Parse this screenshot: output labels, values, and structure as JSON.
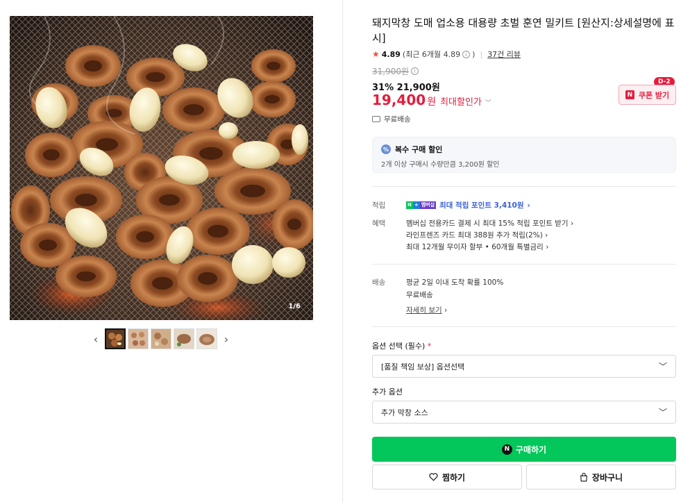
{
  "gallery": {
    "counter": "1/6",
    "prev_icon": "chevron-left-icon",
    "next_icon": "chevron-right-icon",
    "thumb_count": 5,
    "prev_glyph": "‹",
    "next_glyph": "›"
  },
  "product": {
    "title": "돼지막창 도매 업소용 대용량 초벌 훈연 밀키트 [원산지:상세설명에 표시]",
    "rating": "4.89",
    "recent_rating": "(최근 6개월 4.89",
    "recent_close": ")",
    "review_link": "37건 리뷰",
    "original_price": "31,900원",
    "discount_pct": "31%",
    "sale_price": "21,900원",
    "max_price": "19,400",
    "won": "원",
    "max_label": "최대할인가",
    "shipping": "무료배송"
  },
  "coupon": {
    "label": "쿠폰 받기",
    "badge": "D-2",
    "n_mark": "N"
  },
  "multi_discount": {
    "title": "복수 구매 할인",
    "desc": "2개 이상 구매시 수량만큼 3,200원 할인",
    "icon": "%"
  },
  "benefits": {
    "points_label": "적립",
    "points_text": "최대 적립 포인트 3,410원",
    "benefit_label": "혜택",
    "benefit_lines": [
      "멤버십 전용카드 결제 시 최대 15% 적립 포인트 받기",
      "라인프렌즈 카드 최대 388원 추가 적립(2%)",
      "최대 12개월 무이자 할부 • 60개월 특별금리"
    ]
  },
  "delivery": {
    "label": "배송",
    "line1": "평균 2일 이내 도착 확률 100%",
    "line2": "무료배송",
    "detail_link": "자세히 보기"
  },
  "options": {
    "required_label": "옵션 선택 (필수)",
    "required_mark": "*",
    "required_value": "[품질 책임 보상] 옵션선택",
    "extra_label": "추가 옵션",
    "extra_value": "추가 막창 소스"
  },
  "actions": {
    "buy": "구매하기",
    "buy_mark": "N",
    "wishlist": "찜하기",
    "cart": "장바구니"
  },
  "colors": {
    "accent_red": "#e41d3d",
    "naver_green": "#03c75a",
    "link_blue": "#3c62d8"
  }
}
